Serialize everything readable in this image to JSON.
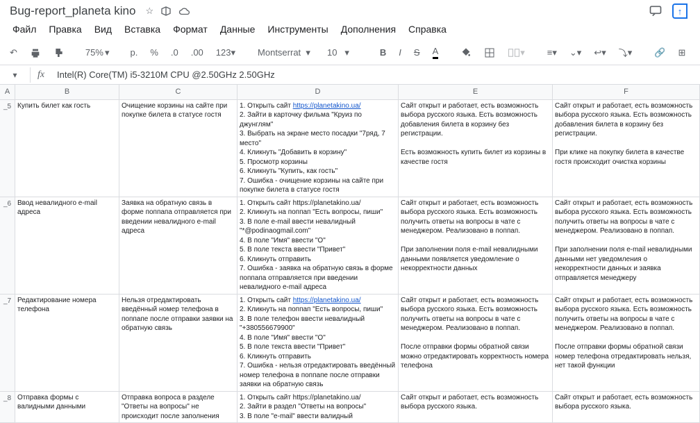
{
  "doc": {
    "title": "Bug-report_planeta kino"
  },
  "menu": {
    "file": "Файл",
    "edit": "Правка",
    "view": "Вид",
    "insert": "Вставка",
    "format": "Формат",
    "data": "Данные",
    "tools": "Инструменты",
    "addons": "Дополнения",
    "help": "Справка"
  },
  "toolbar": {
    "zoom": "75%",
    "currency": "р.",
    "pct": "%",
    "dec_dec": ".0",
    "dec_inc": ".00",
    "num": "123",
    "font": "Montserrat",
    "size": "10"
  },
  "fx": {
    "value": "Intel(R) Core(TM) i5-3210M CPU @2.50GHz  2.50GHz"
  },
  "cols": {
    "a": "A",
    "b": "B",
    "c": "C",
    "d": "D",
    "e": "E",
    "f": "F"
  },
  "rows": {
    "r5": {
      "id": "_5",
      "b": "Купить билет как гость",
      "c": "Очищение корзины на сайте при покупке билета в статусе гостя",
      "d_pre": "1. Открыть сайт ",
      "d_link": "https://planetakino.ua/",
      "d_post": "\n2. Зайти в карточку фильма \"Круиз по джунглям\"\n3. Выбрать на экране место посадки \"7ряд, 7 место\"\n4. Кликнуть \"Добавить в корзину\"\n5. Просмотр корзины\n6. Кликнуть \"Купить, как гость\"\n7. Ошибка - очищение корзины на сайте при покупке билета в статусе гостя",
      "e": "Сайт открыт и работает, есть возможность выбора русского языка. Есть возможность добавления билета в корзину без регистрации.\n\nЕсть возможность купить билет из корзины в качестве гостя",
      "f": "Сайт открыт и работает, есть возможность выбора русского языка. Есть возможность добавления билета в корзину без регистрации.\n\nПри клике на покупку билета в качестве гостя происходит очистка корзины"
    },
    "r6": {
      "id": "_6",
      "b": "Ввод невалидного e-mail адреса",
      "c": "Заявка на обратную связь в форме поппапа отправляется при введении невалидного e-mail адреса",
      "d": "1. Открыть сайт https://planetakino.ua/\n2. Кликнуть на поппап \"Есть вопросы, пиши\"\n3. В поле e-mail ввести невалидный \"*@podinаogmail.com\"\n4. В поле \"Имя\" ввести \"О\"\n5. В поле текста ввести \"Привет\"\n6. Кликнуть отправить\n7. Ошибка - заявка на обратную связь в форме поппапа отправляется при введении невалидного e-mail адреса",
      "e": "Сайт открыт и работает, есть возможность выбора русского языка. Есть возможность получить ответы на вопросы в чате с менеджером. Реализовано в поппап.\n\nПри заполнении поля e-mail невалидными данными появляется уведомление о некорректности данных",
      "f": "Сайт открыт и работает, есть возможность выбора русского языка. Есть возможность получить ответы на вопросы в чате с менеджером. Реализовано в поппап.\n\nПри заполнении поля e-mail невалидными данными нет уведомления о некорректности данных и заявка отправляется менеджеру"
    },
    "r7": {
      "id": "_7",
      "b": "Редактирование номера телефона",
      "c": "Нельзя отредактировать введённый номер телефона в поппапе после отправки заявки на обратную связь",
      "d_pre": "1. Открыть сайт ",
      "d_link": "https://planetakino.ua/",
      "d_post": "\n2. Кликнуть на поппап \"Есть вопросы, пиши\"\n3. В поле телефон ввести невалидный \"+380556679900\"\n4. В поле \"Имя\" ввести \"О\"\n5. В поле текста ввести \"Привет\"\n6. Кликнуть отправить\n7. Ошибка - нельзя отредактировать введённый номер телефона в поппапе после отправки заявки на обратную связь",
      "e": "Сайт открыт и работает, есть возможность выбора русского языка. Есть возможность получить ответы на вопросы в чате с менеджером. Реализовано в поппап.\n\nПосле отправки формы обратной связи можно отредактировать корректность номера телефона",
      "f": "Сайт открыт и работает, есть возможность выбора русского языка. Есть возможность получить ответы на вопросы в чате с менеджером. Реализовано в поппап.\n\nПосле отправки формы обратной связи номер телефона отредактировать нельзя, нет такой функции"
    },
    "r8": {
      "id": "_8",
      "b": "Отправка формы с валидными данными",
      "c": "Отправка вопроса в разделе \"Ответы на вопросы\" не происходит после заполнения",
      "d": "1. Открыть сайт https://planetakino.ua/\n2. Зайти в раздел \"Ответы на вопросы\"\n3. В поле \"e-mail\" ввести валидный",
      "e": "Сайт открыт и работает, есть возможность выбора русского языка.",
      "f": "Сайт открыт и работает, есть возможность выбора русского языка."
    }
  }
}
